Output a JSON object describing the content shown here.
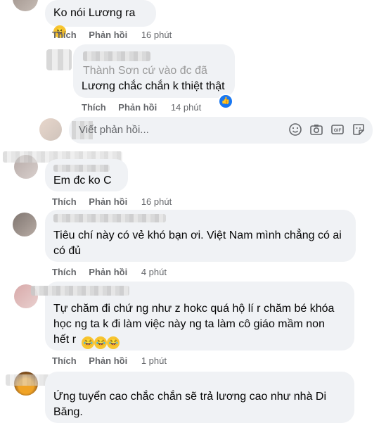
{
  "comments": [
    {
      "text": "Ko nói Lương ra",
      "actions": {
        "like": "Thích",
        "reply": "Phản hồi",
        "time": "16 phút"
      }
    },
    {
      "text_line1": "Thành Sơn cứ vào đc đã",
      "text_line2": "Lương chắc chắn k thiệt thật",
      "actions": {
        "like": "Thích",
        "reply": "Phản hồi",
        "time": "14 phút"
      }
    },
    {
      "text": "Em đc ko C",
      "actions": {
        "like": "Thích",
        "reply": "Phản hồi",
        "time": "16 phút"
      }
    },
    {
      "text_line1": "Tiêu chí này có vẻ khó bạn ơi. Việt Nam mình chẳng có ai",
      "text_line2": "có đủ",
      "actions": {
        "like": "Thích",
        "reply": "Phản hồi",
        "time": "4 phút"
      }
    },
    {
      "text_line1": "Tự chăm đi chứ ng như z hokc quá hộ lí r chăm bé khóa",
      "text_line2": "học ng ta k đi làm việc này ng ta làm cô giáo mầm non",
      "text_line3": "hết r",
      "actions": {
        "like": "Thích",
        "reply": "Phản hồi",
        "time": "1 phút"
      }
    },
    {
      "text_line1": "Ứng tuyển cao chắc chắn sẽ trả lương cao như nhà Di",
      "text_line2": "Băng."
    }
  ],
  "reply_input": {
    "placeholder": "Viết phản hồi..."
  },
  "icons": [
    "emoji-icon",
    "camera-icon",
    "gif-icon",
    "sticker-icon",
    "like-reaction-icon",
    "laughing-emoji-icon"
  ],
  "colors": {
    "bubble": "#f0f2f5",
    "meta": "#65676b",
    "like_blue": "#1877f2"
  }
}
